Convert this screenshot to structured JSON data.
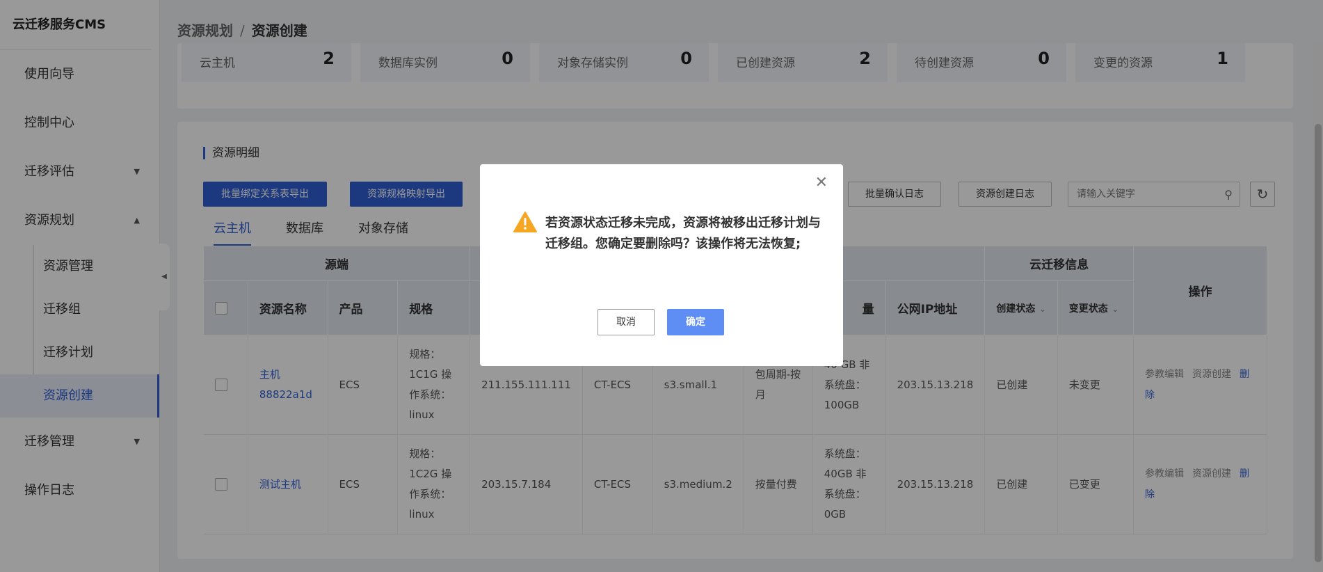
{
  "sidebar": {
    "brand": "云迁移服务CMS",
    "items": {
      "guide": "使用向导",
      "console": "控制中心",
      "assess": "迁移评估",
      "plan": "资源规划",
      "manage": "迁移管理",
      "log": "操作日志"
    },
    "sub_items": {
      "resource_mgmt": "资源管理",
      "migration_group": "迁移组",
      "migration_plan": "迁移计划",
      "resource_create": "资源创建"
    }
  },
  "breadcrumb": {
    "parent": "资源规划",
    "sep": "/",
    "current": "资源创建"
  },
  "stats": [
    {
      "label": "云主机",
      "value": "2"
    },
    {
      "label": "数据库实例",
      "value": "0"
    },
    {
      "label": "对象存储实例",
      "value": "0"
    },
    {
      "label": "已创建资源",
      "value": "2"
    },
    {
      "label": "待创建资源",
      "value": "0"
    },
    {
      "label": "变更的资源",
      "value": "1"
    }
  ],
  "detail": {
    "title": "资源明细",
    "buttons": {
      "export_bind": "批量绑定关系表导出",
      "export_spec": "资源规格映射导出",
      "confirm_log": "批量确认日志",
      "create_log": "资源创建日志"
    },
    "search_placeholder": "请输入关键字",
    "tabs": {
      "vm": "云主机",
      "db": "数据库",
      "oss": "对象存储"
    }
  },
  "table": {
    "group_source": "源端",
    "group_migration": "云迁移信息",
    "col_ops": "操作",
    "headers": {
      "name": "资源名称",
      "product": "产品",
      "spec": "规格",
      "disk": "量",
      "public_ip": "公网IP地址",
      "create_status": "创建状态",
      "change_status": "变更状态"
    },
    "rows": [
      {
        "name": "主机88822a1d",
        "product": "ECS",
        "spec": "规格：1C1G 操作系统：linux",
        "ip": "211.155.111.111",
        "target_product": "CT-ECS",
        "target_spec": "s3.small.1",
        "billing": "包周期-按月",
        "disk": "40 GB 非系统盘：100GB",
        "public_ip": "203.15.13.218",
        "create_status": "已创建",
        "change_status": "未变更"
      },
      {
        "name": "测试主机",
        "product": "ECS",
        "spec": "规格：1C2G 操作系统：linux",
        "ip": "203.15.7.184",
        "target_product": "CT-ECS",
        "target_spec": "s3.medium.2",
        "billing": "按量付费",
        "disk": "系统盘：40GB 非系统盘：0GB",
        "public_ip": "203.15.13.218",
        "create_status": "已创建",
        "change_status": "已变更"
      }
    ],
    "ops": {
      "edit": "参教编辑",
      "create": "资源创建",
      "delete": "删除"
    }
  },
  "modal": {
    "message": "若资源状态迁移未完成，资源将被移出迁移计划与迁移组。您确定要删除吗？该操作将无法恢复;",
    "cancel": "取消",
    "confirm": "确定"
  },
  "colors": {
    "primary": "#2f5fd6",
    "warning": "#f5a623",
    "ok_button": "#5e8ef3"
  }
}
